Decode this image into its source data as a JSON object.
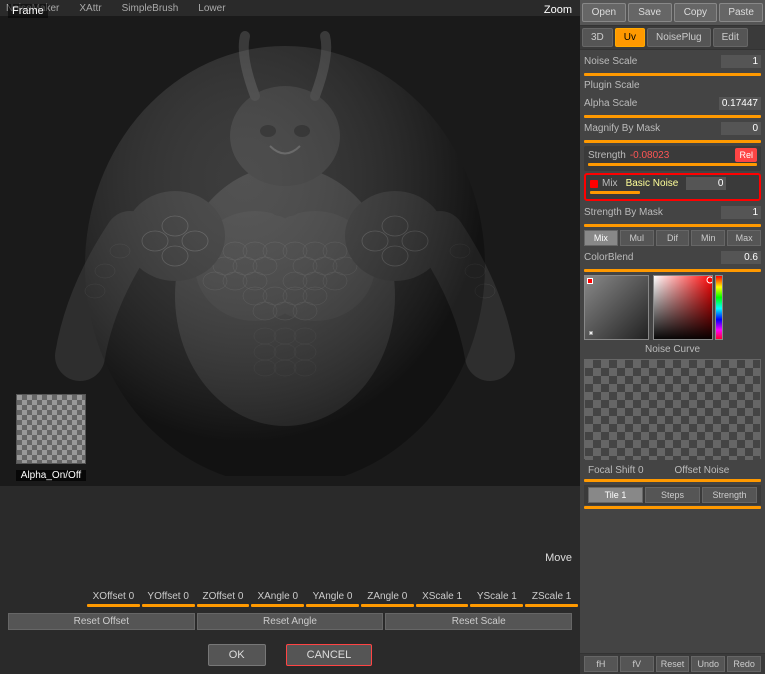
{
  "titleBar": {
    "appName": "NoiseMaker",
    "xAttr": "XAttr",
    "simpleBrush": "SimpleBrush",
    "lower": "Lower"
  },
  "topButtons": {
    "open": "Open",
    "save": "Save",
    "copy": "Copy",
    "paste": "Paste"
  },
  "tabs": {
    "items": [
      {
        "label": "3D",
        "active": false
      },
      {
        "label": "Uv",
        "active": true
      },
      {
        "label": "NoisePlug",
        "active": false
      },
      {
        "label": "Edit",
        "active": false
      }
    ]
  },
  "params": {
    "noiseScale": {
      "label": "Noise Scale",
      "value": "1"
    },
    "pluginScale": {
      "label": "Plugin Scale",
      "value": ""
    },
    "alphaScale": {
      "label": "Alpha Scale",
      "value": "0.17447"
    },
    "magnifyByMask": {
      "label": "Magnify By Mask",
      "value": "0"
    },
    "strength": {
      "label": "Strength",
      "value": "-0.08023"
    },
    "mix": {
      "label": "Mix",
      "subLabel": "Basic Noise",
      "value": "0"
    },
    "strengthByMask": {
      "label": "Strength By Mask",
      "value": "1"
    },
    "colorBlend": {
      "label": "ColorBlend",
      "value": "0.6"
    },
    "focalShift": {
      "label": "Focal Shift",
      "value": "0"
    },
    "offsetNoise": {
      "label": "Offset Noise",
      "value": ""
    },
    "tile": {
      "label": "Tile",
      "value": "1"
    },
    "steps": {
      "label": "Steps",
      "value": ""
    },
    "strength2": {
      "label": "Strength",
      "value": ""
    }
  },
  "blendModes": {
    "items": [
      {
        "label": "Mix",
        "active": true
      },
      {
        "label": "Mul",
        "active": false
      },
      {
        "label": "Dif",
        "active": false
      },
      {
        "label": "Min",
        "active": false
      },
      {
        "label": "Max",
        "active": false
      }
    ]
  },
  "noiseSection": {
    "label": "Noise Curve"
  },
  "toolRow": {
    "fH": "fH",
    "fV": "fV",
    "reset": "Reset",
    "undo": "Undo",
    "redo": "Redo"
  },
  "viewport": {
    "frameLabel": "Frame",
    "zoomLabel": "Zoom"
  },
  "alphaPreview": {
    "label": "Alpha_On/Off"
  },
  "moveLabel": "Move",
  "offsets": [
    {
      "label": "XOffset 0"
    },
    {
      "label": "YOffset 0"
    },
    {
      "label": "ZOffset 0"
    },
    {
      "label": "XAngle 0"
    },
    {
      "label": "YAngle 0"
    },
    {
      "label": "ZAngle 0"
    },
    {
      "label": "XScale 1"
    },
    {
      "label": "YScale 1"
    },
    {
      "label": "ZScale 1"
    }
  ],
  "resetButtons": [
    {
      "label": "Reset Offset"
    },
    {
      "label": "Reset Angle"
    },
    {
      "label": "Reset Scale"
    }
  ],
  "okCancel": {
    "ok": "OK",
    "cancel": "CANCEL"
  },
  "relButton": "Rel"
}
